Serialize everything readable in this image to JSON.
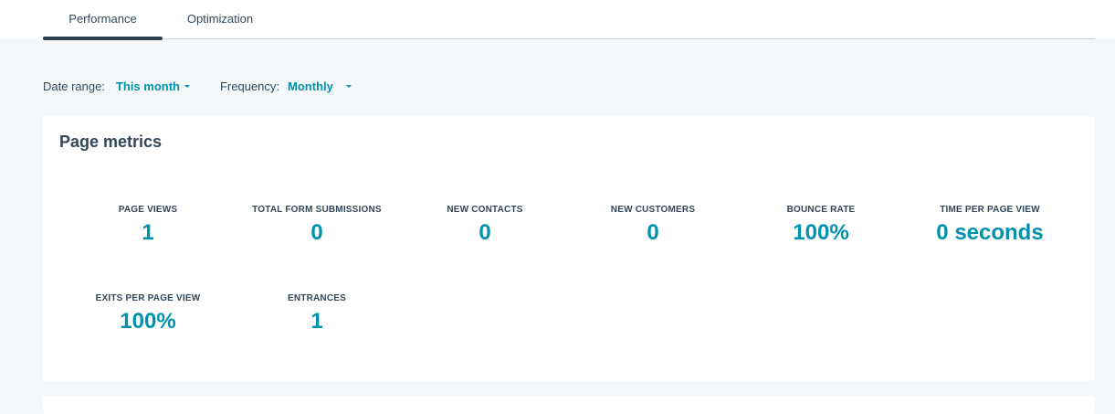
{
  "tabs": {
    "performance": "Performance",
    "optimization": "Optimization"
  },
  "filters": {
    "date_range_label": "Date range:",
    "date_range_value": "This month",
    "frequency_label": "Frequency:",
    "frequency_value": "Monthly"
  },
  "card": {
    "title": "Page metrics",
    "metrics": [
      {
        "label": "PAGE VIEWS",
        "value": "1"
      },
      {
        "label": "TOTAL FORM SUBMISSIONS",
        "value": "0"
      },
      {
        "label": "NEW CONTACTS",
        "value": "0"
      },
      {
        "label": "NEW CUSTOMERS",
        "value": "0"
      },
      {
        "label": "BOUNCE RATE",
        "value": "100%"
      },
      {
        "label": "TIME PER PAGE VIEW",
        "value": "0 seconds"
      },
      {
        "label": "EXITS PER PAGE VIEW",
        "value": "100%"
      },
      {
        "label": "ENTRANCES",
        "value": "1"
      }
    ]
  },
  "colors": {
    "accent": "#0091ae",
    "text": "#33475b",
    "background": "#f5f8fa",
    "tab_indicator": "#2d3e50"
  }
}
